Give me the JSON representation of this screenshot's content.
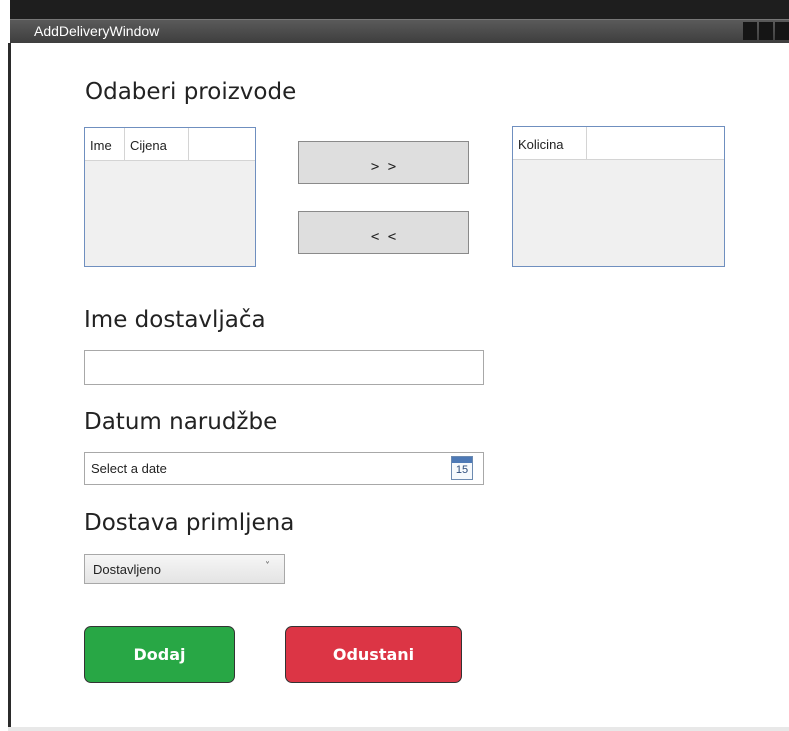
{
  "window": {
    "title": "AddDeliveryWindow"
  },
  "products": {
    "heading": "Odaberi proizvode",
    "left_grid_columns": [
      "Ime",
      "Cijena"
    ],
    "right_grid_columns": [
      "Kolicina"
    ],
    "move_right_label": "> >",
    "move_left_label": "< <"
  },
  "supplier": {
    "heading": "Ime dostavljača",
    "value": ""
  },
  "order_date": {
    "heading": "Datum narudžbe",
    "placeholder": "Select a date",
    "calendar_day": "15"
  },
  "received": {
    "heading": "Dostava primljena",
    "selected": "Dostavljeno"
  },
  "actions": {
    "add_label": "Dodaj",
    "cancel_label": "Odustani"
  },
  "colors": {
    "add_button": "#28a745",
    "cancel_button": "#dc3545",
    "grid_border": "#6f8fbf"
  },
  "icons": {
    "calendar": "calendar-icon",
    "dropdown": "chevron-down-icon"
  }
}
